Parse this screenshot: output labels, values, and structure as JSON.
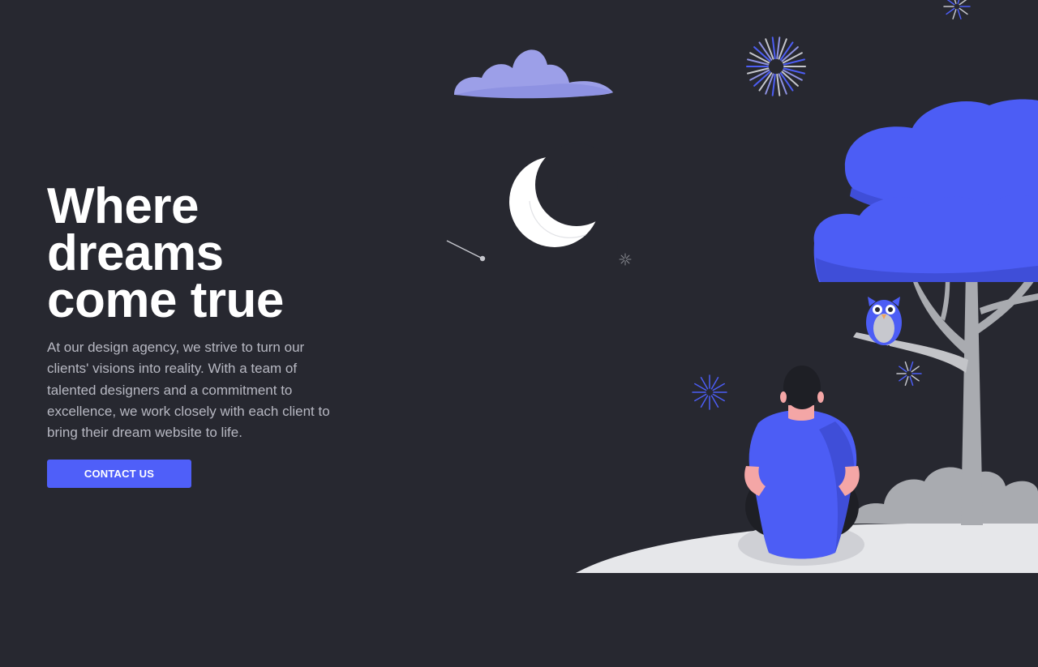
{
  "hero": {
    "title_lines": [
      "Where",
      "dreams",
      "come true"
    ],
    "description": "At our design agency, we strive to turn our clients' visions into reality. With a team of talented designers and a commitment to excellence, we work closely with each client to bring their dream website to life.",
    "cta_label": "CONTACT US"
  },
  "colors": {
    "background": "#272830",
    "accent": "#4f5ff9",
    "title": "#ffffff",
    "body_text": "#b7b8c2",
    "cloud": "#9c9fe8",
    "moon": "#ffffff",
    "ground": "#e6e7ea",
    "trunk": "#a9abb0"
  },
  "illustration": {
    "icons": [
      "cloud-icon",
      "moon-icon",
      "firework-icon",
      "shooting-star-icon",
      "tree-icon",
      "owl-icon",
      "person-icon",
      "bush-icon"
    ]
  }
}
